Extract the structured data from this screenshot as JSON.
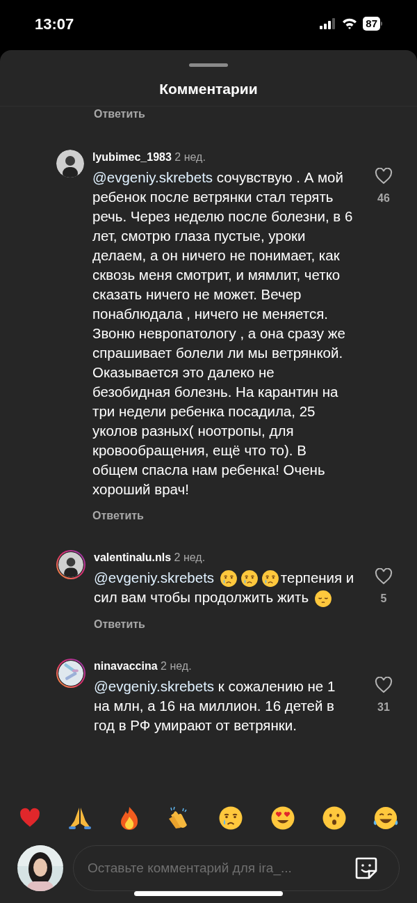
{
  "status_bar": {
    "time": "13:07",
    "battery": "87"
  },
  "sheet": {
    "title": "Комментарии",
    "cut_reply": "Ответить"
  },
  "comments": [
    {
      "user": "lyubimec_1983",
      "time": "2 нед.",
      "ring": false,
      "mention": "@evgeniy.skrebets",
      "parts": [
        {
          "kind": "text",
          "text": "сочувствую . А мой ребенок после ветрянки стал терять речь. Через неделю после болезни, в 6 лет, смотрю глаза пустые, уроки делаем, а он ничего не понимает, как сквозь меня смотрит, и мямлит, четко сказать ничего не может. Вечер понаблюдала , ничего не меняется. Звоню невропатологу , а она сразу же спрашивает болели ли мы ветрянкой. Оказывается это далеко не безобидная болезнь. На карантин на три недели ребенка посадила, 25 уколов разных( ноотропы, для кровообращения, ещё что то). В общем спасла нам ребенка! Очень хороший врач!"
        }
      ],
      "likes": "46",
      "reply": "Ответить"
    },
    {
      "user": "valentinalu.nls",
      "time": "2 нед.",
      "ring": true,
      "mention": "@evgeniy.skrebets",
      "parts": [
        {
          "kind": "crying"
        },
        {
          "kind": "crying"
        },
        {
          "kind": "crying"
        },
        {
          "kind": "text",
          "text": "терпения и сил вам чтобы продолжить жить"
        },
        {
          "kind": "pensive"
        }
      ],
      "likes": "5",
      "reply": "Ответить"
    },
    {
      "user": "ninavaccina",
      "time": "2 нед.",
      "ring": true,
      "mention": "@evgeniy.skrebets",
      "parts": [
        {
          "kind": "text",
          "text": "к сожалению не 1 на млн, а 16 на миллион. 16 детей в год в РФ умирают от ветрянки."
        }
      ],
      "likes": "31"
    }
  ],
  "composer": {
    "placeholder": "Оставьте комментарий для ira_..."
  }
}
